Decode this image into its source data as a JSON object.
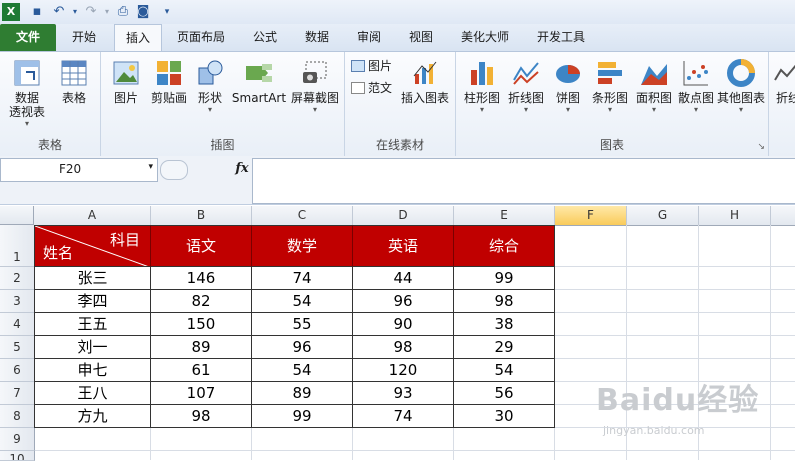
{
  "qat": {
    "items": [
      "excel-icon",
      "save-icon",
      "undo-icon",
      "redo-icon",
      "print-preview-icon",
      "camera-icon",
      "qat-more-icon"
    ]
  },
  "tabs": [
    {
      "label": "文件"
    },
    {
      "label": "开始"
    },
    {
      "label": "插入"
    },
    {
      "label": "页面布局"
    },
    {
      "label": "公式"
    },
    {
      "label": "数据"
    },
    {
      "label": "审阅"
    },
    {
      "label": "视图"
    },
    {
      "label": "美化大师"
    },
    {
      "label": "开发工具"
    }
  ],
  "active_tab": "插入",
  "ribbon": {
    "groups": [
      {
        "label": "表格",
        "buttons": [
          {
            "label": "数据\n透视表",
            "caret": true
          },
          {
            "label": "表格"
          }
        ]
      },
      {
        "label": "插图",
        "buttons": [
          {
            "label": "图片"
          },
          {
            "label": "剪贴画"
          },
          {
            "label": "形状",
            "caret": true
          },
          {
            "label": "SmartArt"
          },
          {
            "label": "屏幕截图",
            "caret": true
          }
        ]
      },
      {
        "label": "在线素材",
        "small": [
          {
            "label": "图片"
          },
          {
            "label": "范文"
          }
        ],
        "buttons": [
          {
            "label": "插入图表"
          }
        ]
      },
      {
        "label": "图表",
        "buttons": [
          {
            "label": "柱形图"
          },
          {
            "label": "折线图"
          },
          {
            "label": "饼图"
          },
          {
            "label": "条形图"
          },
          {
            "label": "面积图"
          },
          {
            "label": "散点图"
          },
          {
            "label": "其他图表"
          }
        ]
      },
      {
        "label": "",
        "buttons": [
          {
            "label": "折线"
          }
        ]
      }
    ]
  },
  "namebox": {
    "value": "F20"
  },
  "fx_label": "fx",
  "columns": [
    "A",
    "B",
    "C",
    "D",
    "E",
    "F",
    "G",
    "H"
  ],
  "selected_column": "F",
  "rows": [
    "1",
    "2",
    "3",
    "4",
    "5",
    "6",
    "7",
    "8",
    "9",
    "10"
  ],
  "table": {
    "corner_top": "科目",
    "corner_bottom": "姓名",
    "headers": [
      "语文",
      "数学",
      "英语",
      "综合"
    ],
    "data": [
      [
        "张三",
        "146",
        "74",
        "44",
        "99"
      ],
      [
        "李四",
        "82",
        "54",
        "96",
        "98"
      ],
      [
        "王五",
        "150",
        "55",
        "90",
        "38"
      ],
      [
        "刘一",
        "89",
        "96",
        "98",
        "29"
      ],
      [
        "申七",
        "61",
        "54",
        "120",
        "54"
      ],
      [
        "王八",
        "107",
        "89",
        "93",
        "56"
      ],
      [
        "方九",
        "98",
        "99",
        "74",
        "30"
      ]
    ]
  },
  "colors": {
    "header_fill": "#c00000",
    "file_tab": "#2f7d32",
    "selected_col": "#f9cb5b"
  },
  "watermark": {
    "brand": "Baidu经验",
    "url": "jingyan.baidu.com"
  }
}
